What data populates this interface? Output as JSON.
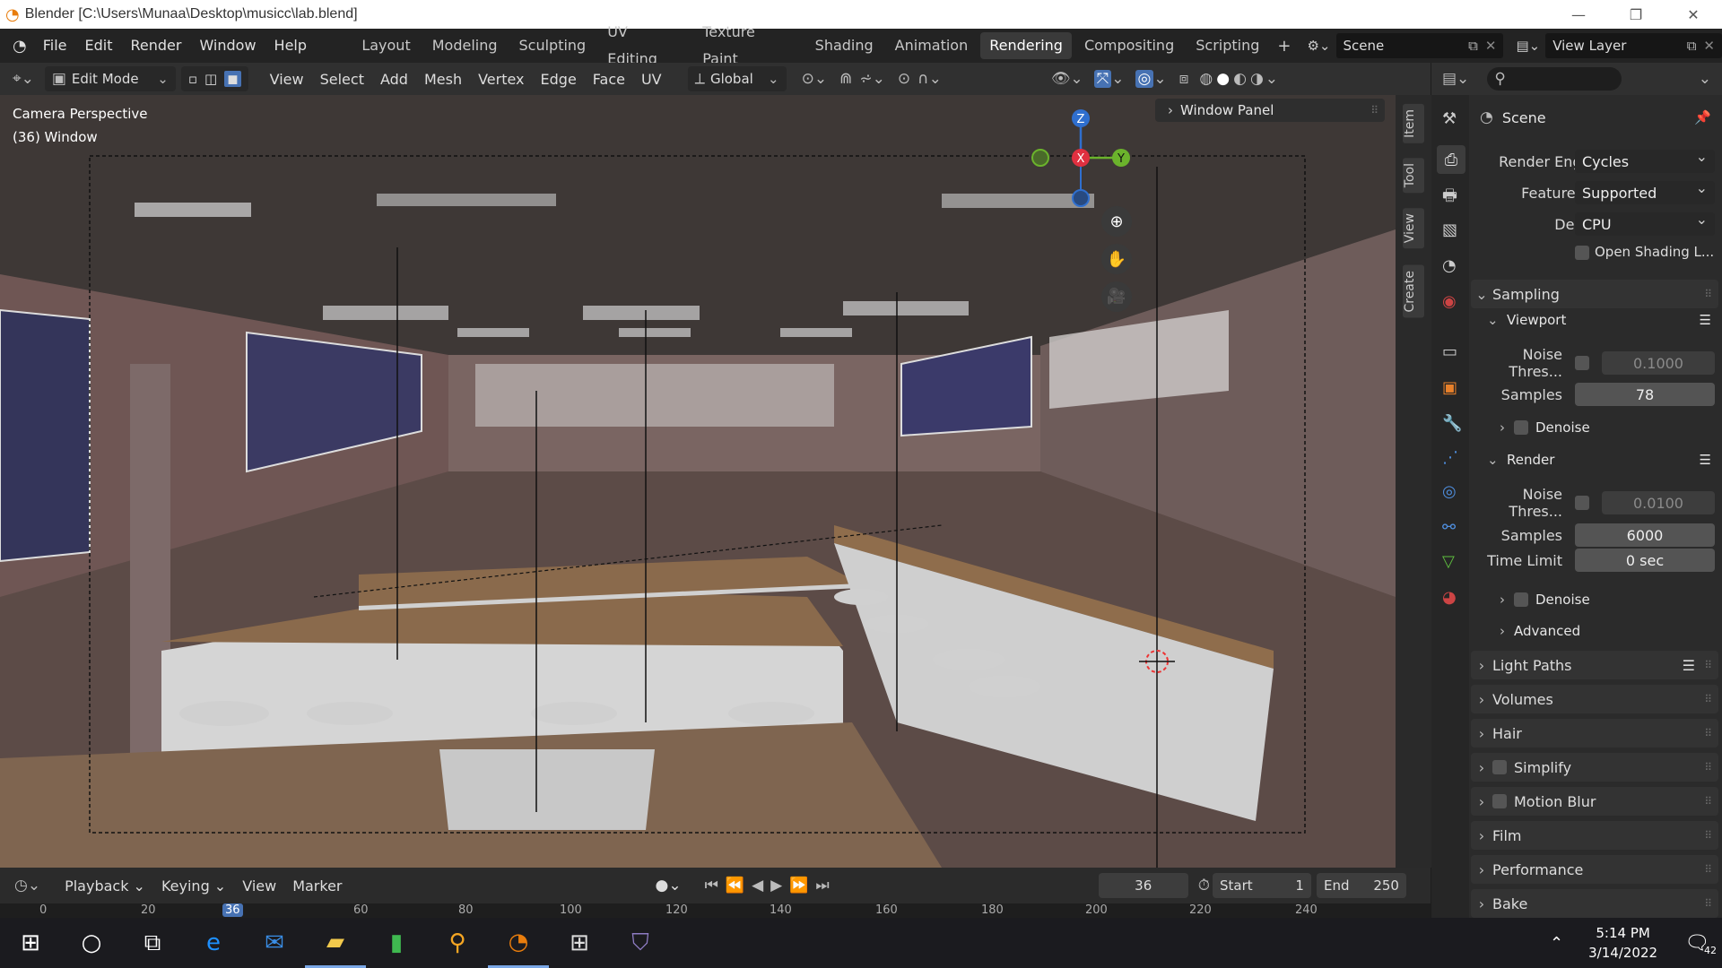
{
  "window": {
    "title": "Blender [C:\\Users\\Munaa\\Desktop\\musicc\\lab.blend]",
    "minimize": "—",
    "restore": "❐",
    "close": "✕"
  },
  "menu": [
    "File",
    "Edit",
    "Render",
    "Window",
    "Help"
  ],
  "workspaces": [
    "Layout",
    "Modeling",
    "Sculpting",
    "UV Editing",
    "Texture Paint",
    "Shading",
    "Animation",
    "Rendering",
    "Compositing",
    "Scripting"
  ],
  "active_workspace": "Rendering",
  "scene_name": "Scene",
  "view_layer": "View Layer",
  "viewport_header": {
    "mode": "Edit Mode",
    "menus": [
      "View",
      "Select",
      "Add",
      "Mesh",
      "Vertex",
      "Edge",
      "Face",
      "UV"
    ],
    "transform": "Global"
  },
  "viewport": {
    "camera_label": "Camera Perspective",
    "object_label": "(36) Window",
    "window_panel": "Window Panel",
    "gizmo": {
      "z": "Z",
      "x": "X",
      "y": "Y"
    },
    "side_tabs": [
      "Item",
      "Tool",
      "View",
      "Create"
    ]
  },
  "properties": {
    "header": "Scene",
    "search_placeholder": "",
    "render_engine_label": "Render Engine",
    "render_engine": "Cycles",
    "feature_set_label": "Feature Set",
    "feature_set": "Supported",
    "device_label": "Device",
    "device": "CPU",
    "open_shading": "Open Shading L...",
    "sampling": "Sampling",
    "viewport_sub": "Viewport",
    "noise_thres_label": "Noise Thres...",
    "viewport_noise": "0.1000",
    "samples_label": "Samples",
    "viewport_samples": "78",
    "denoise": "Denoise",
    "render_sub": "Render",
    "render_noise": "0.0100",
    "render_samples": "6000",
    "time_limit_label": "Time Limit",
    "time_limit": "0 sec",
    "advanced": "Advanced",
    "panels": [
      "Light Paths",
      "Volumes",
      "Hair",
      "Simplify",
      "Motion Blur",
      "Film",
      "Performance",
      "Bake"
    ]
  },
  "timeline": {
    "playback": "Playback",
    "keying": "Keying",
    "view": "View",
    "marker": "Marker",
    "current_frame": "36",
    "start_label": "Start",
    "start": "1",
    "end_label": "End",
    "end": "250",
    "ticks": [
      "0",
      "20",
      "36",
      "60",
      "80",
      "100",
      "120",
      "140",
      "160",
      "180",
      "200",
      "220",
      "240"
    ]
  },
  "taskbar": {
    "time": "5:14 PM",
    "date": "3/14/2022",
    "notifications": "42"
  }
}
